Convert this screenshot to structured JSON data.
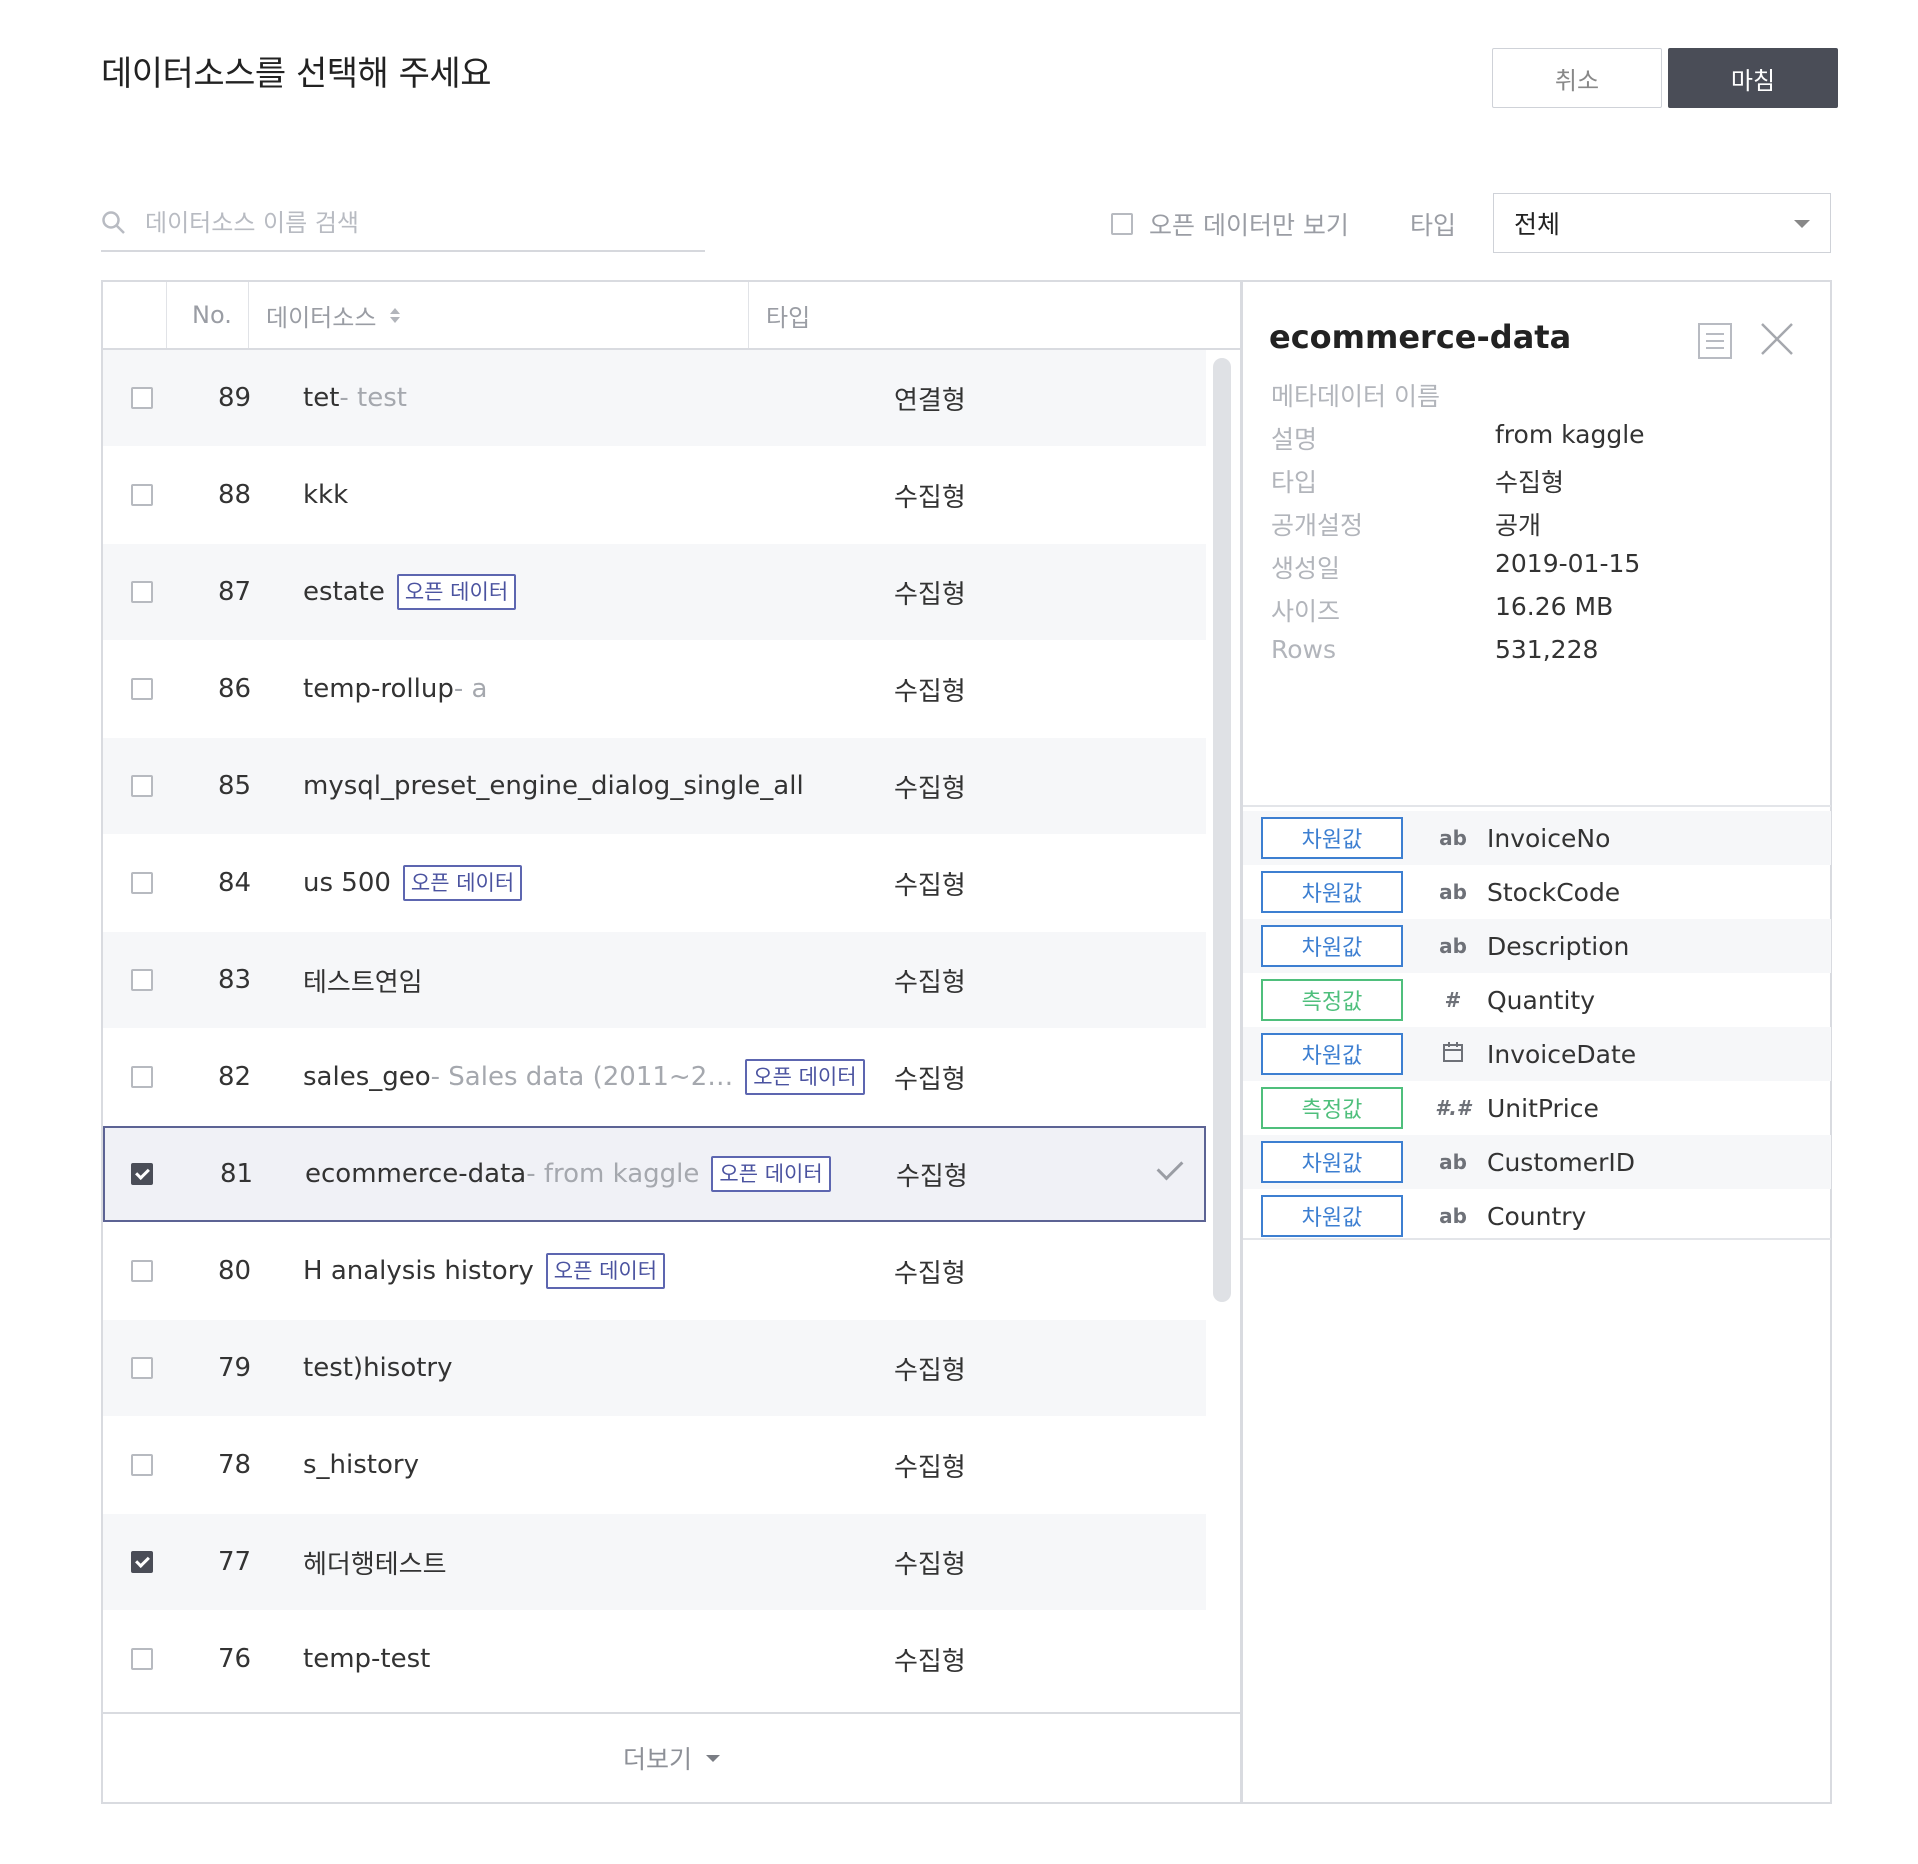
{
  "header": {
    "title": "데이터소스를 선택해 주세요",
    "cancel_label": "취소",
    "done_label": "마침"
  },
  "filters": {
    "search_placeholder": "데이터소스 이름 검색",
    "open_only_label": "오픈 데이터만 보기",
    "type_label": "타입",
    "type_selected": "전체"
  },
  "table": {
    "columns": {
      "no": "No.",
      "name": "데이터소스",
      "type": "타입"
    },
    "rows": [
      {
        "no": "89",
        "name": "tet",
        "desc": " - test",
        "badge": "",
        "type": "연결형",
        "checked": false
      },
      {
        "no": "88",
        "name": "kkk",
        "desc": "",
        "badge": "",
        "type": "수집형",
        "checked": false
      },
      {
        "no": "87",
        "name": "estate",
        "desc": "",
        "badge": "오픈 데이터",
        "type": "수집형",
        "checked": false
      },
      {
        "no": "86",
        "name": "temp-rollup",
        "desc": " - a",
        "badge": "",
        "type": "수집형",
        "checked": false
      },
      {
        "no": "85",
        "name": "mysql_preset_engine_dialog_single_all",
        "desc": "",
        "badge": "",
        "type": "수집형",
        "checked": false
      },
      {
        "no": "84",
        "name": "us 500",
        "desc": "",
        "badge": "오픈 데이터",
        "type": "수집형",
        "checked": false
      },
      {
        "no": "83",
        "name": "테스트연임",
        "desc": "",
        "badge": "",
        "type": "수집형",
        "checked": false
      },
      {
        "no": "82",
        "name": "sales_geo",
        "desc": " - Sales data (2011~2…",
        "badge": "오픈 데이터",
        "type": "수집형",
        "checked": false
      },
      {
        "no": "81",
        "name": "ecommerce-data",
        "desc": " - from kaggle",
        "badge": "오픈 데이터",
        "type": "수집형",
        "checked": true
      },
      {
        "no": "80",
        "name": "H analysis history",
        "desc": "",
        "badge": "오픈 데이터",
        "type": "수집형",
        "checked": false
      },
      {
        "no": "79",
        "name": "test)hisotry",
        "desc": "",
        "badge": "",
        "type": "수집형",
        "checked": false
      },
      {
        "no": "78",
        "name": "s_history",
        "desc": "",
        "badge": "",
        "type": "수집형",
        "checked": false
      },
      {
        "no": "77",
        "name": "헤더행테스트",
        "desc": "",
        "badge": "",
        "type": "수집형",
        "checked": true
      },
      {
        "no": "76",
        "name": "temp-test",
        "desc": "",
        "badge": "",
        "type": "수집형",
        "checked": false
      }
    ],
    "selected_row_no": "81",
    "more_label": "더보기"
  },
  "detail": {
    "title": "ecommerce-data",
    "meta": [
      {
        "key": "메타데이터 이름",
        "value": ""
      },
      {
        "key": "설명",
        "value": "from kaggle"
      },
      {
        "key": "타입",
        "value": "수집형"
      },
      {
        "key": "공개설정",
        "value": "공개"
      },
      {
        "key": "생성일",
        "value": "2019-01-15"
      },
      {
        "key": "사이즈",
        "value": "16.26 MB"
      },
      {
        "key": "Rows",
        "value": "531,228"
      }
    ],
    "columns": [
      {
        "role": "차원값",
        "role_kind": "dimension",
        "type_icon": "ab",
        "name": "InvoiceNo"
      },
      {
        "role": "차원값",
        "role_kind": "dimension",
        "type_icon": "ab",
        "name": "StockCode"
      },
      {
        "role": "차원값",
        "role_kind": "dimension",
        "type_icon": "ab",
        "name": "Description"
      },
      {
        "role": "측정값",
        "role_kind": "measure",
        "type_icon": "#",
        "name": "Quantity"
      },
      {
        "role": "차원값",
        "role_kind": "dimension",
        "type_icon": "calendar",
        "name": "InvoiceDate"
      },
      {
        "role": "측정값",
        "role_kind": "measure",
        "type_icon": "#.#",
        "name": "UnitPrice"
      },
      {
        "role": "차원값",
        "role_kind": "dimension",
        "type_icon": "ab",
        "name": "CustomerID"
      },
      {
        "role": "차원값",
        "role_kind": "dimension",
        "type_icon": "ab",
        "name": "Country"
      }
    ]
  },
  "colors": {
    "accent_dark": "#4a4d57",
    "badge": "#5d66b0",
    "dimension": "#3d7fd1",
    "measure": "#4fbf7c"
  }
}
